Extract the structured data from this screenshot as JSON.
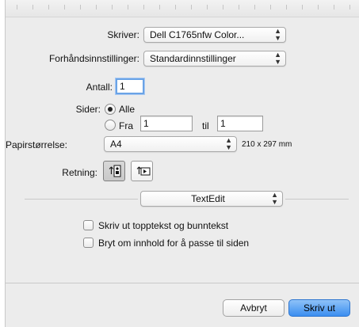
{
  "printer": {
    "label": "Skriver:",
    "value": "Dell C1765nfw Color..."
  },
  "presets": {
    "label": "Forhåndsinnstillinger:",
    "value": "Standardinnstillinger"
  },
  "copies": {
    "label": "Antall:",
    "value": "1"
  },
  "pages": {
    "label": "Sider:",
    "all_label": "Alle",
    "from_label": "Fra",
    "from_value": "1",
    "to_label": "til",
    "to_value": "1",
    "selected": "all"
  },
  "paper": {
    "label": "Papirstørrelse:",
    "value": "A4",
    "dimensions": "210 x 297 mm"
  },
  "orientation": {
    "label": "Retning:",
    "selected": "portrait"
  },
  "app_section": {
    "value": "TextEdit"
  },
  "options": [
    {
      "label": "Skriv ut topptekst og bunntekst",
      "checked": false
    },
    {
      "label": "Bryt om innhold for å passe til siden",
      "checked": false
    }
  ],
  "buttons": {
    "cancel": "Avbryt",
    "print": "Skriv ut"
  },
  "popup_arrows": {
    "up": "▲",
    "down": "▼"
  }
}
